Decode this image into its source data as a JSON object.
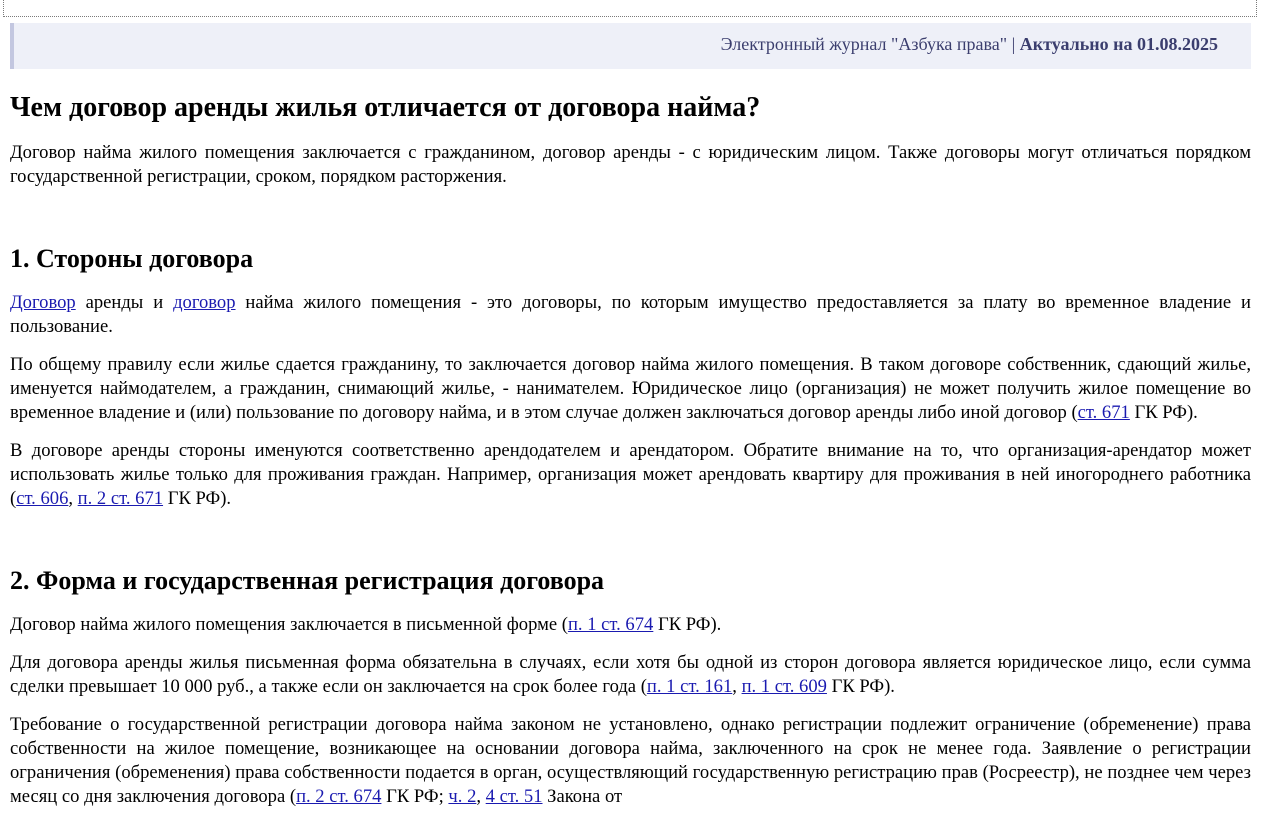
{
  "header": {
    "journal": "Электронный журнал \"Азбука права\"",
    "separator": " | ",
    "actual": "Актуально на 01.08.2025"
  },
  "article": {
    "title": "Чем договор аренды жилья отличается от договора найма?",
    "intro": "Договор найма жилого помещения заключается с гражданином, договор аренды - с юридическим лицом. Также договоры могут отличаться порядком государственной регистрации, сроком, порядком расторжения.",
    "section1": {
      "title": "1. Стороны договора",
      "p1": {
        "link1": "Договор",
        "t1": " аренды и ",
        "link2": "договор",
        "t2": " найма жилого помещения - это договоры, по которым имущество предоставляется за плату во временное владение и пользование."
      },
      "p2": {
        "t1": "По общему правилу если жилье сдается гражданину, то заключается договор найма жилого помещения. В таком договоре собственник, сдающий жилье, именуется наймодателем, а гражданин, снимающий жилье, - нанимателем. Юридическое лицо (организация) не может получить жилое помещение во временное владение и (или) пользование по договору найма, и в этом случае должен заключаться договор аренды либо иной договор (",
        "link1": "ст. 671",
        "t2": " ГК РФ)."
      },
      "p3": {
        "t1": "В договоре аренды стороны именуются соответственно арендодателем и арендатором. Обратите внимание на то, что организация-арендатор может использовать жилье только для проживания граждан. Например, организация может арендовать квартиру для проживания в ней иногороднего работника (",
        "link1": "ст. 606",
        "t2": ", ",
        "link2": "п. 2 ст. 671",
        "t3": " ГК РФ)."
      }
    },
    "section2": {
      "title": "2. Форма и государственная регистрация договора",
      "p1": {
        "t1": "Договор найма жилого помещения заключается в письменной форме (",
        "link1": "п. 1 ст. 674",
        "t2": " ГК РФ)."
      },
      "p2": {
        "t1": "Для договора аренды жилья письменная форма обязательна в случаях, если хотя бы одной из сторон договора является юридическое лицо, если сумма сделки превышает 10 000 руб., а также если он заключается на срок более года (",
        "link1": "п. 1 ст. 161",
        "t2": ", ",
        "link2": "п. 1 ст. 609",
        "t3": " ГК РФ)."
      },
      "p3": {
        "t1": "Требование о государственной регистрации договора найма законом не установлено, однако регистрации подлежит ограничение (обременение) права собственности на жилое помещение, возникающее на основании договора найма, заключенного на срок не менее года. Заявление о регистрации ограничения (обременения) права собственности подается в орган, осуществляющий государственную регистрацию прав (Росреестр), не позднее чем через месяц со дня заключения договора (",
        "link1": "п. 2 ст. 674",
        "t2": " ГК РФ; ",
        "link2": "ч. 2",
        "t3": ", ",
        "link3": "4 ст. 51",
        "t4": " Закона от"
      }
    }
  }
}
